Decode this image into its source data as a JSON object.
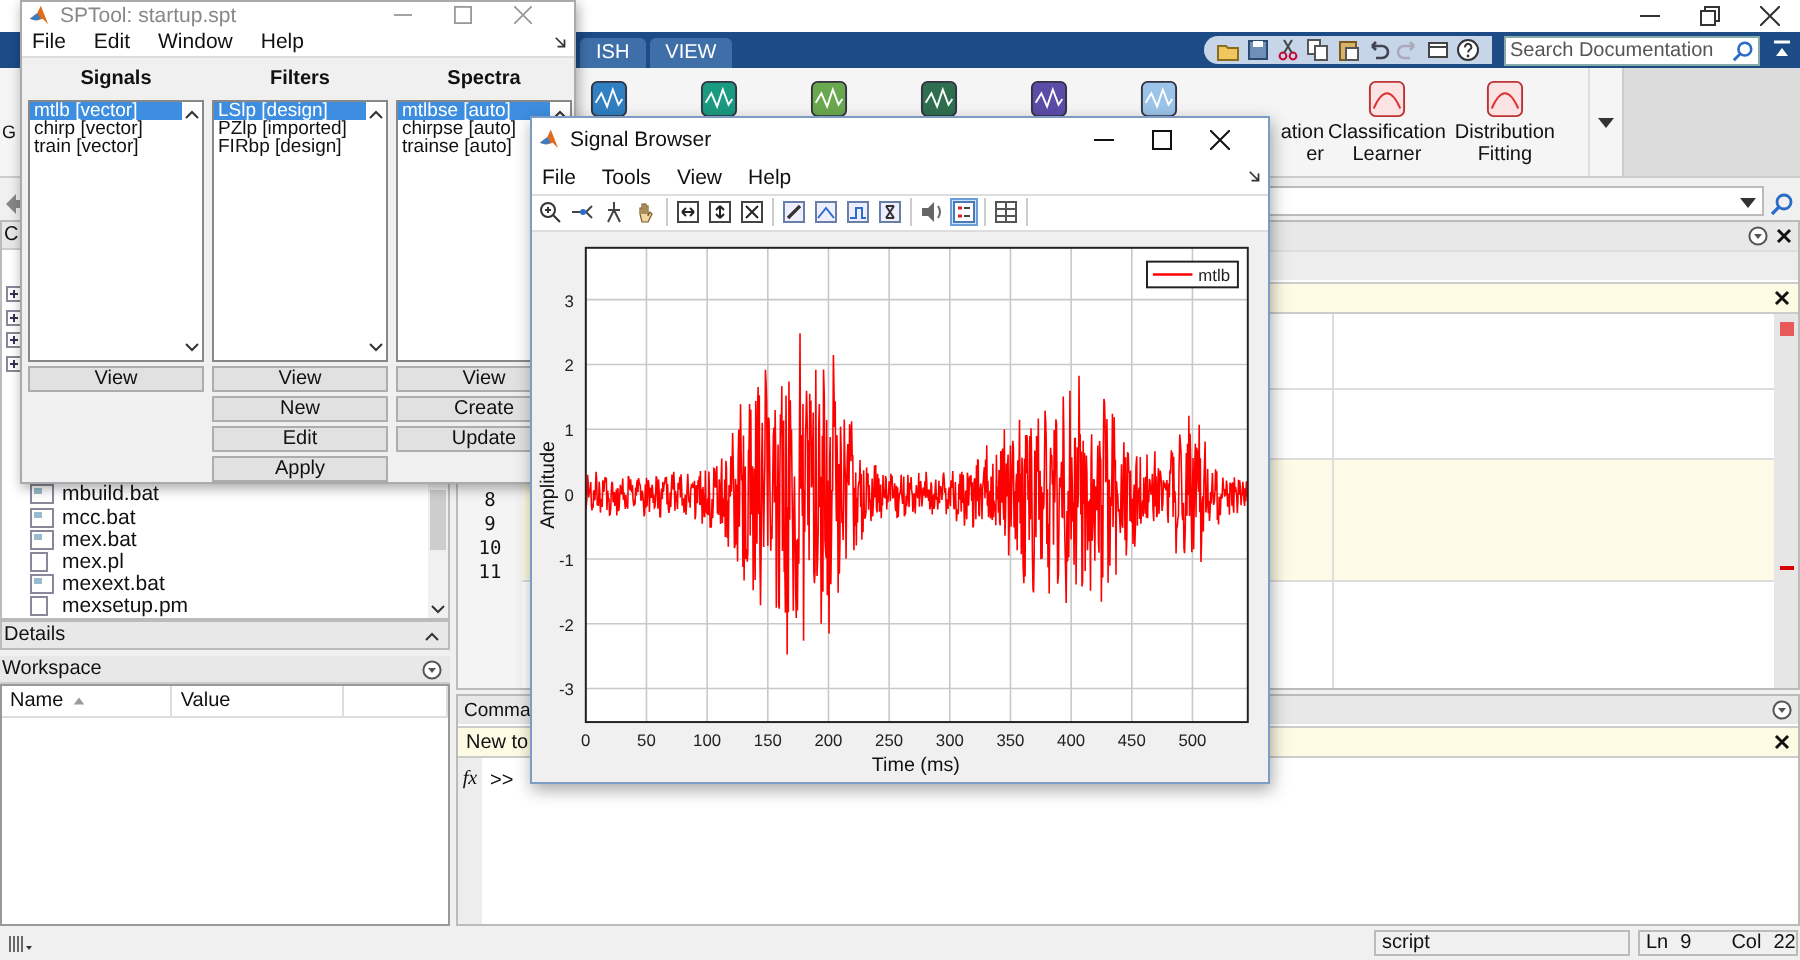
{
  "main_window": {
    "ribbon_tabs": [
      {
        "label": "ISH",
        "selected": false
      },
      {
        "label": "VIEW",
        "selected": false
      }
    ],
    "search": {
      "placeholder": "Search Documentation"
    },
    "ribbon_fragment": "G",
    "apps": [
      {
        "kind": "cut",
        "lines": [
          "ation",
          "er"
        ]
      },
      {
        "kind": "full",
        "lines": [
          "Classification",
          "Learner"
        ]
      },
      {
        "kind": "full",
        "lines": [
          "Distribution",
          "Fitting"
        ]
      }
    ],
    "current_folder": {
      "title": "C",
      "files": [
        {
          "name": "mbuild.bat",
          "kind": "script"
        },
        {
          "name": "mcc.bat",
          "kind": "script"
        },
        {
          "name": "mex.bat",
          "kind": "script"
        },
        {
          "name": "mex.pl",
          "kind": "plain"
        },
        {
          "name": "mexext.bat",
          "kind": "script"
        },
        {
          "name": "mexsetup.pm",
          "kind": "plain"
        }
      ]
    },
    "details": {
      "title": "Details"
    },
    "workspace": {
      "title": "Workspace",
      "columns": [
        {
          "label": "Name",
          "sorted": true
        },
        {
          "label": "Value",
          "sorted": false
        }
      ]
    },
    "editor": {
      "line_numbers": [
        "8",
        "9",
        "10",
        "11"
      ]
    },
    "command_window": {
      "title": "Comma",
      "banner": "New to",
      "fx_label": "fx",
      "prompt": ">>"
    },
    "status_bar": {
      "mode": "script",
      "ln_label": "Ln",
      "ln": "9",
      "col_label": "Col",
      "col": "22"
    }
  },
  "sptool": {
    "title": "SPTool: startup.spt",
    "menu": [
      "File",
      "Edit",
      "Window",
      "Help"
    ],
    "columns": [
      {
        "title": "Signals",
        "items": [
          {
            "label": "mtlb [vector]",
            "selected": true
          },
          {
            "label": "chirp [vector]",
            "selected": false
          },
          {
            "label": "train [vector]",
            "selected": false
          }
        ],
        "buttons": [
          "View"
        ]
      },
      {
        "title": "Filters",
        "items": [
          {
            "label": "LSlp [design]",
            "selected": true
          },
          {
            "label": "PZlp [imported]",
            "selected": false
          },
          {
            "label": "FIRbp [design]",
            "selected": false
          }
        ],
        "buttons": [
          "View",
          "New",
          "Edit",
          "Apply"
        ]
      },
      {
        "title": "Spectra",
        "items": [
          {
            "label": "mtlbse [auto]",
            "selected": true
          },
          {
            "label": "chirpse [auto]",
            "selected": false
          },
          {
            "label": "trainse [auto]",
            "selected": false
          }
        ],
        "buttons": [
          "View",
          "Create",
          "Update"
        ]
      }
    ]
  },
  "signal_browser": {
    "title": "Signal Browser",
    "menu": [
      "File",
      "Tools",
      "View",
      "Help"
    ],
    "toolbar_groups": [
      [
        {
          "kind": "zoom",
          "selected": false
        },
        {
          "kind": "cursor",
          "selected": false
        },
        {
          "kind": "ruler",
          "selected": false
        },
        {
          "kind": "pan",
          "selected": false
        }
      ],
      [
        {
          "kind": "fitx",
          "selected": false
        },
        {
          "kind": "fity",
          "selected": false
        },
        {
          "kind": "fitall",
          "selected": false
        }
      ],
      [
        {
          "kind": "pencil",
          "selected": false
        },
        {
          "kind": "peak",
          "selected": false
        },
        {
          "kind": "step",
          "selected": false
        },
        {
          "kind": "bracket",
          "selected": false
        }
      ],
      [
        {
          "kind": "speaker",
          "selected": false
        },
        {
          "kind": "legend",
          "selected": true
        }
      ],
      [
        {
          "kind": "grid",
          "selected": false
        }
      ]
    ],
    "plot": {
      "ylabel": "Amplitude",
      "xlabel": "Time (ms)",
      "legend": "mtlb",
      "yticks": [
        "3",
        "2",
        "1",
        "0",
        "-1",
        "-2",
        "-3"
      ],
      "xticks": [
        "0",
        "50",
        "100",
        "150",
        "200",
        "250",
        "300",
        "350",
        "400",
        "450",
        "500"
      ]
    }
  }
}
